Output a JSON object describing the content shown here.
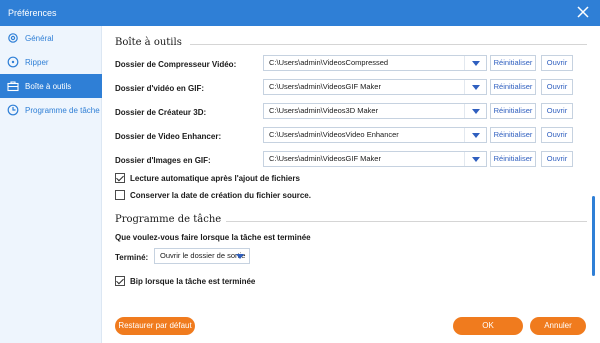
{
  "window": {
    "title": "Préférences"
  },
  "sidebar": {
    "items": [
      {
        "label": "Général",
        "icon": "settings-icon",
        "active": false
      },
      {
        "label": "Ripper",
        "icon": "disc-icon",
        "active": false
      },
      {
        "label": "Boîte à outils",
        "icon": "toolbox-icon",
        "active": true
      },
      {
        "label": "Programme de tâche",
        "icon": "clock-icon",
        "active": false
      }
    ]
  },
  "toolbox": {
    "title": "Boîte à outils",
    "rows": [
      {
        "label": "Dossier de Compresseur Vidéo:",
        "path": "C:\\Users\\admin\\VideosCompressed"
      },
      {
        "label": "Dossier d'vidéo en GIF:",
        "path": "C:\\Users\\admin\\VideosGIF Maker"
      },
      {
        "label": "Dossier de Créateur 3D:",
        "path": "C:\\Users\\admin\\Videos3D Maker"
      },
      {
        "label": "Dossier de Video Enhancer:",
        "path": "C:\\Users\\admin\\VideosVideo Enhancer"
      },
      {
        "label": "Dossier d'Images en GIF:",
        "path": "C:\\Users\\admin\\VideosGIF Maker"
      }
    ],
    "reset_label": "Réinitialiser",
    "open_label": "Ouvrir",
    "checkbox_autoplay": "Lecture automatique après l'ajout de fichiers",
    "checkbox_keep_date": "Conserver la date de création du fichier source."
  },
  "schedule": {
    "title": "Programme de tâche",
    "question": "Que voulez-vous faire lorsque la tâche est terminée",
    "done_label": "Terminé:",
    "done_value": "Ouvrir le dossier de sortie",
    "beep_label": "Bip lorsque la tâche est terminée"
  },
  "footer": {
    "restore_label": "Restaurer par défaut",
    "ok_label": "OK",
    "cancel_label": "Annuler"
  },
  "colors": {
    "accent": "#2f7fd6",
    "orange": "#f07b1e"
  }
}
